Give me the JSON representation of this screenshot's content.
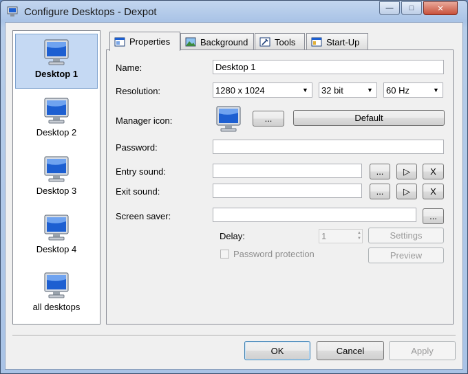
{
  "window": {
    "title": "Configure Desktops - Dexpot",
    "controls": {
      "minimize": "—",
      "maximize": "□",
      "close": "✕"
    }
  },
  "desktops": [
    {
      "label": "Desktop 1",
      "selected": true
    },
    {
      "label": "Desktop 2",
      "selected": false
    },
    {
      "label": "Desktop 3",
      "selected": false
    },
    {
      "label": "Desktop 4",
      "selected": false
    },
    {
      "label": "all desktops",
      "selected": false
    }
  ],
  "tabs": [
    {
      "label": "Properties",
      "icon": "properties-icon",
      "active": true
    },
    {
      "label": "Background",
      "icon": "background-icon",
      "active": false
    },
    {
      "label": "Tools",
      "icon": "tools-icon",
      "active": false
    },
    {
      "label": "Start-Up",
      "icon": "startup-icon",
      "active": false
    }
  ],
  "properties": {
    "name_label": "Name:",
    "name_value": "Desktop 1",
    "resolution_label": "Resolution:",
    "resolution_value": "1280 x 1024",
    "color_depth_value": "32 bit",
    "refresh_value": "60 Hz",
    "manager_icon_label": "Manager icon:",
    "browse_label": "...",
    "default_label": "Default",
    "password_label": "Password:",
    "password_value": "",
    "entry_sound_label": "Entry sound:",
    "entry_sound_value": "",
    "exit_sound_label": "Exit sound:",
    "exit_sound_value": "",
    "play_symbol": "▷",
    "clear_label": "X",
    "screen_saver_label": "Screen saver:",
    "screen_saver_value": "",
    "delay_label": "Delay:",
    "delay_value": "1",
    "settings_label": "Settings",
    "password_protection_label": "Password protection",
    "preview_label": "Preview"
  },
  "footer": {
    "ok_label": "OK",
    "cancel_label": "Cancel",
    "apply_label": "Apply"
  },
  "colors": {
    "selection_bg": "#c5d9f3",
    "monitor_blue": "#1d5fd1"
  }
}
